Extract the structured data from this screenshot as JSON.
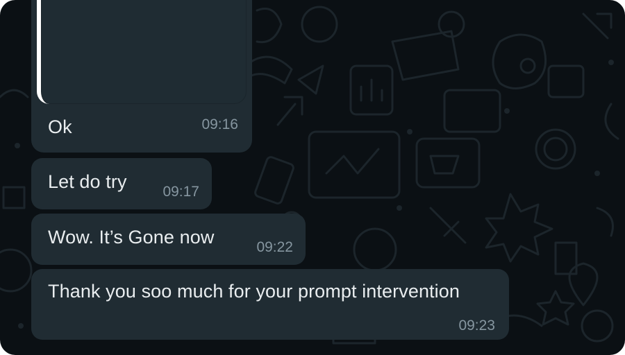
{
  "messages": [
    {
      "text": "Ok",
      "time": "09:16",
      "has_media": true
    },
    {
      "text": "Let do try",
      "time": "09:17"
    },
    {
      "text": "Wow.  It’s Gone now",
      "time": "09:22"
    },
    {
      "text": "Thank you soo much for your prompt intervention",
      "time": "09:23"
    }
  ],
  "colors": {
    "background": "#0b1014",
    "bubble": "#202c33",
    "text": "#e9edef",
    "timestamp": "#8696a0",
    "doodle": "#1c252b"
  }
}
